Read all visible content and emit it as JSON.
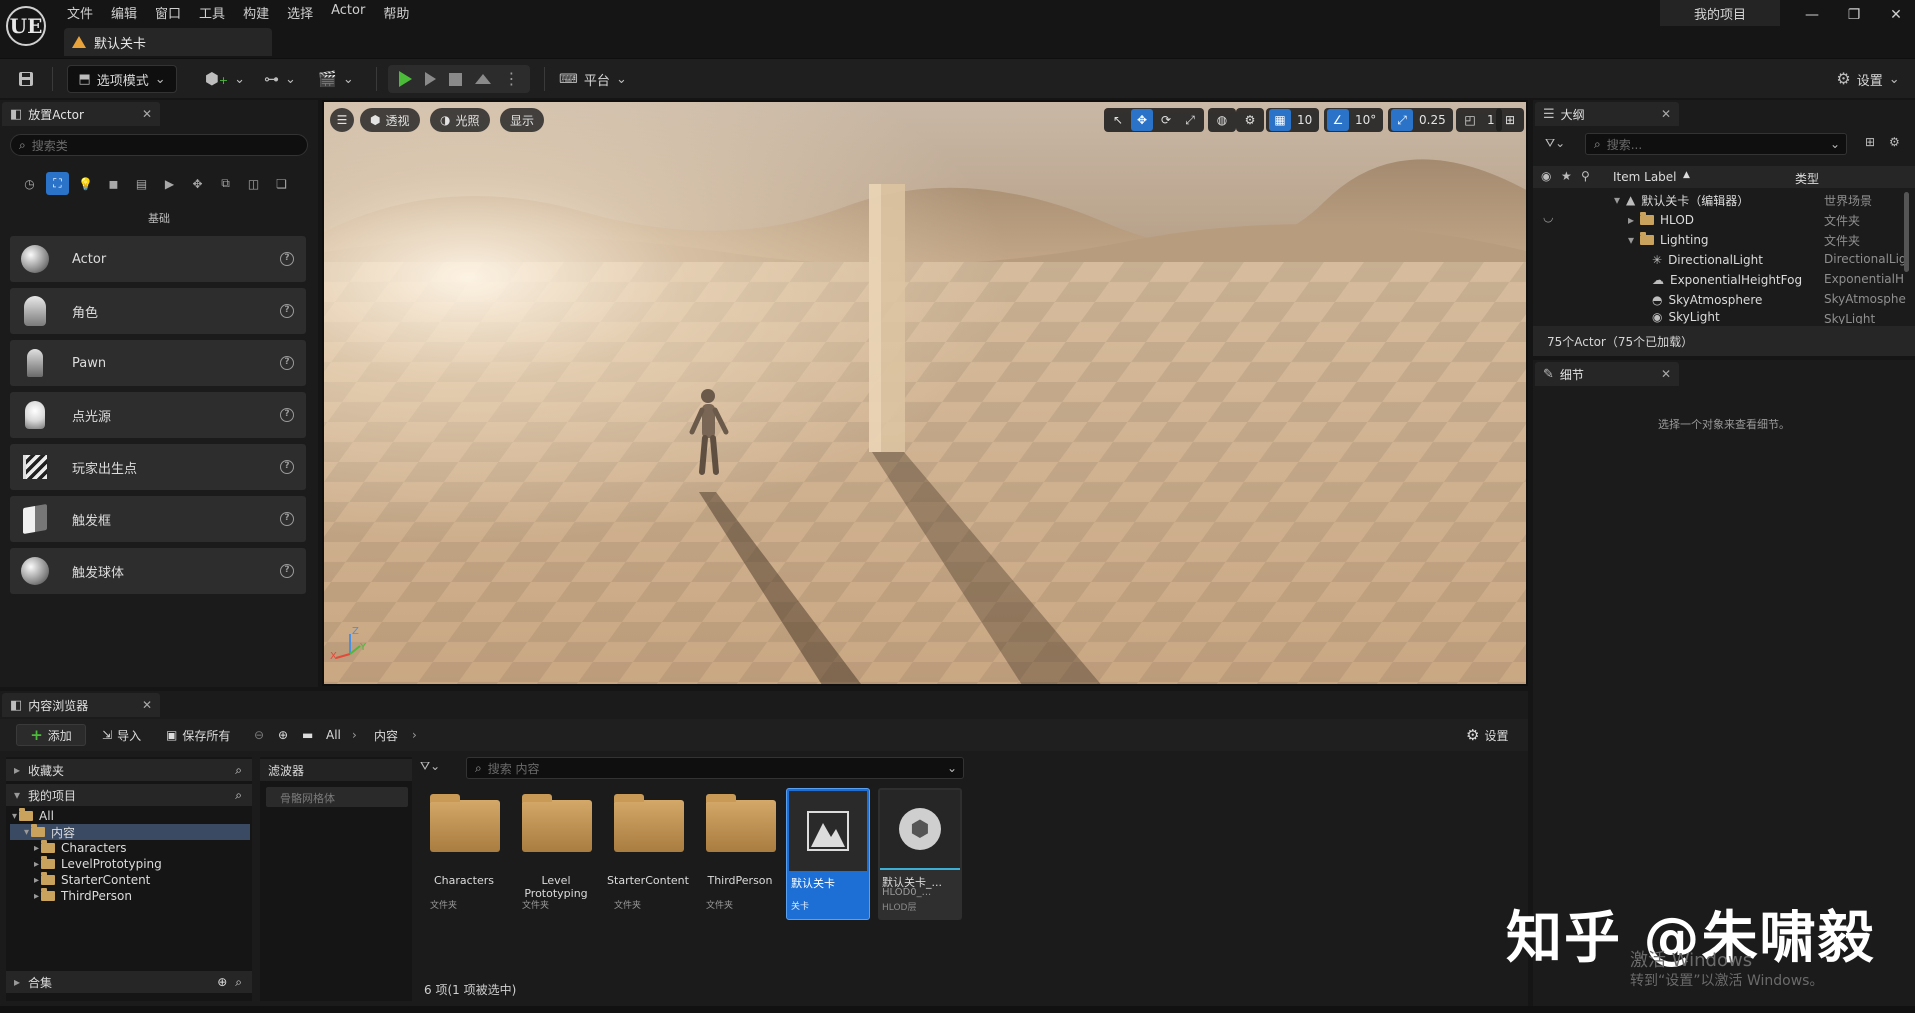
{
  "titlebar": {
    "logo": "UE",
    "menu": [
      "文件",
      "编辑",
      "窗口",
      "工具",
      "构建",
      "选择",
      "Actor",
      "帮助"
    ],
    "level_tab": "默认关卡",
    "project_name": "我的项目",
    "window_controls": [
      "—",
      "❐",
      "✕"
    ]
  },
  "toolbar": {
    "mode": "选项模式",
    "platform": "平台",
    "settings": "设置"
  },
  "place_actors": {
    "tab_label": "放置Actor",
    "search_placeholder": "搜索类",
    "category_label": "基础",
    "items": [
      {
        "label": "Actor",
        "icon": "sphere"
      },
      {
        "label": "角色",
        "icon": "character"
      },
      {
        "label": "Pawn",
        "icon": "pawn"
      },
      {
        "label": "点光源",
        "icon": "bulb"
      },
      {
        "label": "玩家出生点",
        "icon": "flag"
      },
      {
        "label": "触发框",
        "icon": "cube"
      },
      {
        "label": "触发球体",
        "icon": "sphere"
      }
    ]
  },
  "viewport": {
    "perspective": "透视",
    "lighting": "光照",
    "show": "显示",
    "grid_size": "10",
    "rotation_snap": "10°",
    "scale_snap": "0.25",
    "camera_speed": "1",
    "axis_labels": {
      "z": "Z",
      "x": "X",
      "y": "Y"
    }
  },
  "outliner": {
    "tab_label": "大纲",
    "search_placeholder": "搜索...",
    "col_label": "Item Label",
    "col_sort": "▲",
    "col_type": "类型",
    "rows": [
      {
        "label": "默认关卡（编辑器）",
        "type": "世界场景"
      },
      {
        "label": "HLOD",
        "type": "文件夹"
      },
      {
        "label": "Lighting",
        "type": "文件夹"
      },
      {
        "label": "DirectionalLight",
        "type": "DirectionalLig"
      },
      {
        "label": "ExponentialHeightFog",
        "type": "ExponentialH"
      },
      {
        "label": "SkyAtmosphere",
        "type": "SkyAtmosphe"
      },
      {
        "label": "SkyLight",
        "type": "SkyLight"
      }
    ],
    "status": "75个Actor（75个已加载）"
  },
  "details": {
    "tab_label": "细节",
    "empty_msg": "选择一个对象来查看细节。"
  },
  "content_browser": {
    "tab_label": "内容浏览器",
    "add": "添加",
    "import": "导入",
    "save_all": "保存所有",
    "path": [
      "All",
      "内容"
    ],
    "settings": "设置",
    "favorites": "收藏夹",
    "my_project": "我的项目",
    "tree": [
      "All",
      "内容",
      "Characters",
      "LevelPrototyping",
      "StarterContent",
      "ThirdPerson"
    ],
    "collections": "合集",
    "filters_label": "滤波器",
    "filter_chip": "骨骼网格体",
    "search_placeholder": "搜索 内容",
    "assets": [
      {
        "name": "Characters",
        "type": "文件夹"
      },
      {
        "name": "Level Prototyping",
        "type": "文件夹"
      },
      {
        "name": "StarterContent",
        "type": "文件夹"
      },
      {
        "name": "ThirdPerson",
        "type": "文件夹"
      },
      {
        "name": "默认关卡",
        "type": "关卡"
      },
      {
        "name": "默认关卡_...",
        "name2": "HLOD0_...",
        "type": "HLOD层"
      }
    ],
    "status": "6 项(1 项被选中)"
  },
  "watermark": {
    "zh": "知乎 @朱啸毅",
    "win1": "激活 Windows",
    "win2": "转到“设置”以激活 Windows。"
  }
}
